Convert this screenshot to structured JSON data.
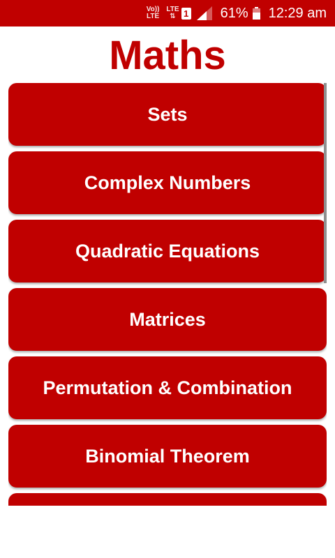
{
  "status_bar": {
    "volte_label_top": "Vo))",
    "volte_label_bottom": "LTE",
    "network_label": "LTE",
    "sim_slot": "1",
    "battery_percent": "61%",
    "battery_level": 0.61,
    "time": "12:29 am",
    "colors": {
      "background": "#c00000",
      "text": "#ffffff"
    }
  },
  "header": {
    "title": "Maths"
  },
  "topics": [
    {
      "label": "Sets"
    },
    {
      "label": "Complex Numbers"
    },
    {
      "label": "Quadratic Equations"
    },
    {
      "label": "Matrices"
    },
    {
      "label": "Permutation & Combination"
    },
    {
      "label": "Binomial Theorem"
    },
    {
      "label": ""
    }
  ],
  "theme": {
    "accent": "#c00000",
    "button_text": "#ffffff",
    "background": "#ffffff"
  }
}
